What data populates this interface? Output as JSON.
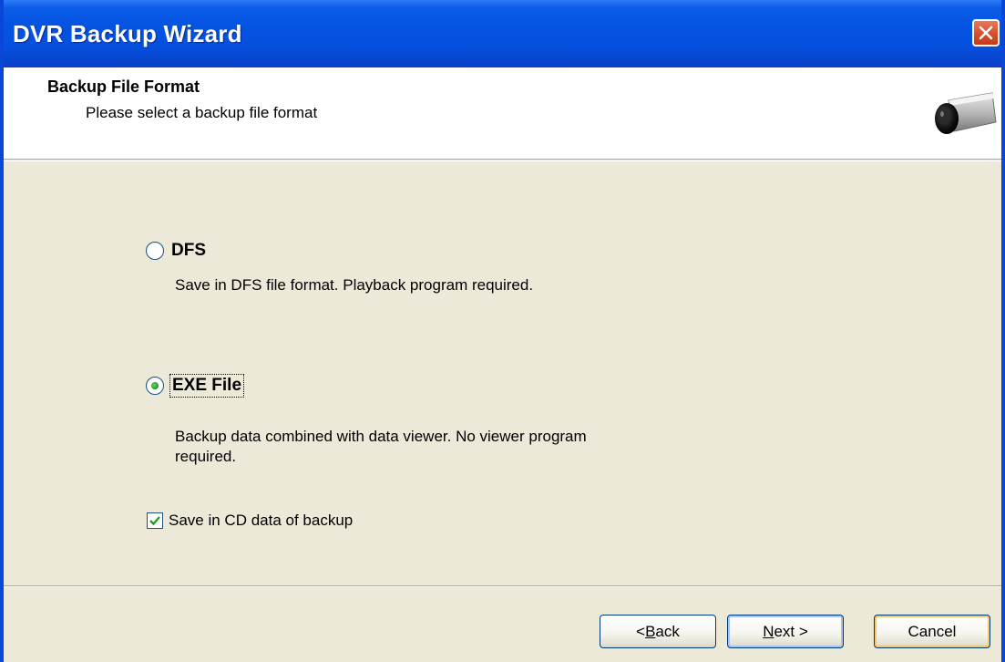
{
  "window": {
    "title": "DVR Backup Wizard"
  },
  "header": {
    "title": "Backup File Format",
    "subtitle": "Please select a backup file format"
  },
  "options": [
    {
      "label": "DFS",
      "description": "Save in DFS file format. Playback program required.",
      "selected": false
    },
    {
      "label": "EXE File",
      "description_line1": "Backup data combined with data viewer. No viewer program",
      "description_line2": "required.",
      "selected": true
    }
  ],
  "checkbox": {
    "label": "Save in CD data of backup",
    "checked": true
  },
  "buttons": {
    "back_pre": "< ",
    "back_mnemonic": "B",
    "back_rest": "ack",
    "next_mnemonic": "N",
    "next_rest": "ext >",
    "cancel": "Cancel"
  },
  "colors": {
    "titlebar": "#0553E1",
    "dialog_bg": "#ECE9D8",
    "close_button": "#D8512E"
  },
  "icons": [
    "close-icon",
    "camera-icon"
  ]
}
